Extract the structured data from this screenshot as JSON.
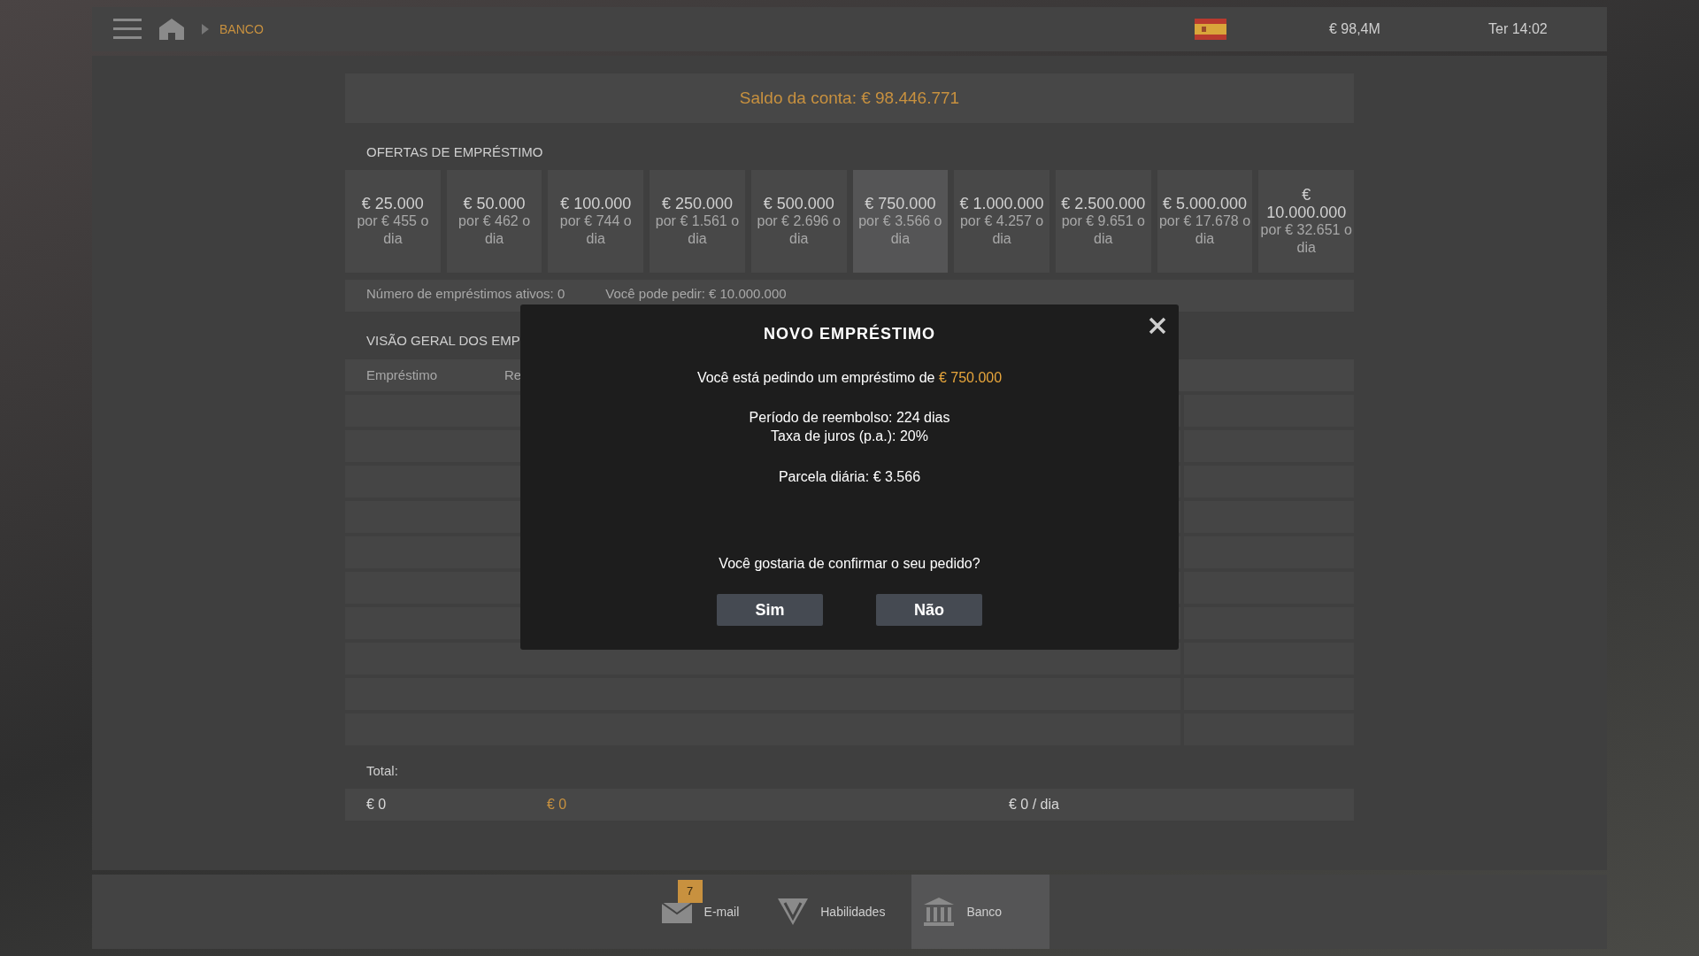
{
  "top_bar": {
    "breadcrumb": "BANCO",
    "money": "€ 98,4M",
    "time": "Ter 14:02"
  },
  "balance": "Saldo da conta: € 98.446.771",
  "offers": {
    "title": "OFERTAS DE EMPRÉSTIMO",
    "items": [
      {
        "amount": "€ 25.000",
        "rate": "por € 455 o dia",
        "selected": false
      },
      {
        "amount": "€ 50.000",
        "rate": "por € 462 o dia",
        "selected": false
      },
      {
        "amount": "€ 100.000",
        "rate": "por € 744 o dia",
        "selected": false
      },
      {
        "amount": "€ 250.000",
        "rate": "por € 1.561 o dia",
        "selected": false
      },
      {
        "amount": "€ 500.000",
        "rate": "por € 2.696 o dia",
        "selected": false
      },
      {
        "amount": "€ 750.000",
        "rate": "por € 3.566 o dia",
        "selected": true
      },
      {
        "amount": "€ 1.000.000",
        "rate": "por € 4.257 o dia",
        "selected": false
      },
      {
        "amount": "€ 2.500.000",
        "rate": "por € 9.651 o dia",
        "selected": false
      },
      {
        "amount": "€ 5.000.000",
        "rate": "por € 17.678 o dia",
        "selected": false
      },
      {
        "amount": "€ 10.000.000",
        "rate": "por € 32.651 o dia",
        "selected": false
      }
    ]
  },
  "info": {
    "active_loans": "Número de empréstimos ativos: 0",
    "can_request": "Você pode pedir: € 10.000.000"
  },
  "overview": {
    "title": "VISÃO GERAL DOS EMP",
    "columns": [
      "Empréstimo",
      "Re"
    ],
    "total_label": "Total:",
    "totals": [
      {
        "text": "€ 0",
        "color": "#d8d8d8"
      },
      {
        "text": "€ 0",
        "color": "#c8913f"
      },
      {
        "text": "€ 0 / dia",
        "color": "#d8d8d8"
      }
    ]
  },
  "modal": {
    "title": "NOVO EMPRÉSTIMO",
    "request": "Você está pedindo um empréstimo de",
    "amount": "€ 750.000",
    "details": [
      "Período de reembolso: 224 dias",
      "Taxa de juros (p.a.): 20%"
    ],
    "installment": "Parcela diária: € 3.566",
    "question": "Você gostaria de confirmar o seu pedido?",
    "buttons": [
      "Sim",
      "Não"
    ]
  },
  "bottom_nav": [
    {
      "kind": "mail",
      "label": "E-mail",
      "badge": "7",
      "selected": false
    },
    {
      "kind": "skills",
      "label": "Habilidades",
      "selected": false
    },
    {
      "kind": "bank",
      "label": "Banco",
      "selected": true
    }
  ]
}
